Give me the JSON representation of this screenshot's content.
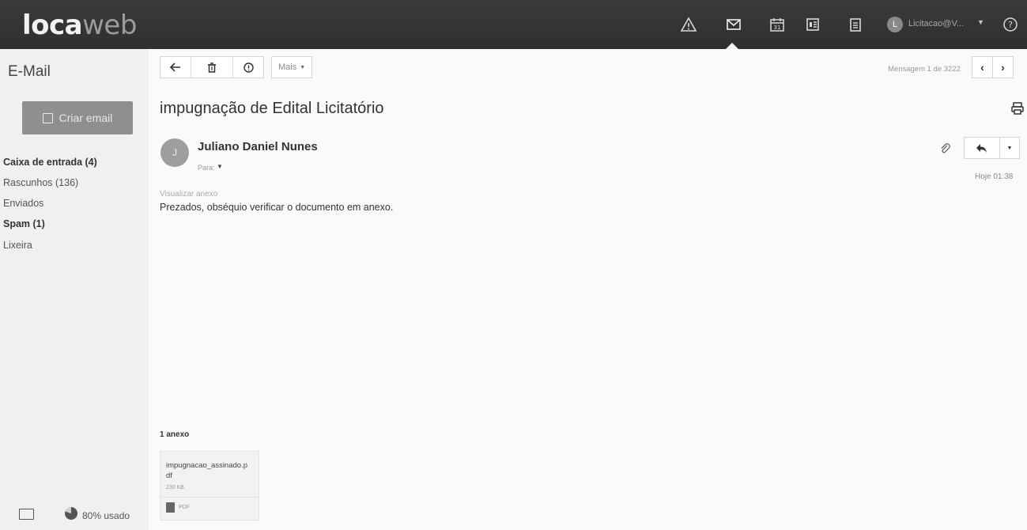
{
  "topbar": {
    "logo_main": "loca",
    "logo_accent": "web",
    "avatar_initial": "L",
    "account_name": "Licitacao@V...",
    "icons": [
      "alert-icon",
      "mail-icon",
      "calendar-icon",
      "contacts-icon",
      "notes-icon",
      "help-icon"
    ]
  },
  "sidebar": {
    "section_title": "E-Mail",
    "compose_label": "Criar email",
    "folders": [
      {
        "label": "Caixa de entrada (4)",
        "bold": true
      },
      {
        "label": "Rascunhos (136)",
        "bold": false
      },
      {
        "label": "Enviados",
        "bold": false
      },
      {
        "label": "Spam (1)",
        "bold": true
      },
      {
        "label": "Lixeira",
        "bold": false
      }
    ],
    "usage_label": "80% usado",
    "usage_fraction": 0.8
  },
  "toolbar": {
    "back": "←",
    "delete": "🗑",
    "info": "ⓘ",
    "more_label": "Mais",
    "message_counter": "Mensagem 1 de 3222"
  },
  "message": {
    "subject": "impugnação de Edital Licitatório",
    "sender_initial": "J",
    "sender_name": "Juliano Daniel Nunes",
    "recipient_label": "Para:",
    "time": "Hoje 01:38",
    "view_attachment": "Visualizar anexo",
    "body": "Prezados, obséquio verificar o documento em anexo.",
    "attachments_count": "1 anexo",
    "attachment": {
      "name": "impugnacao_assinado.pdf",
      "size": "230 KB",
      "type": "PDF"
    }
  }
}
